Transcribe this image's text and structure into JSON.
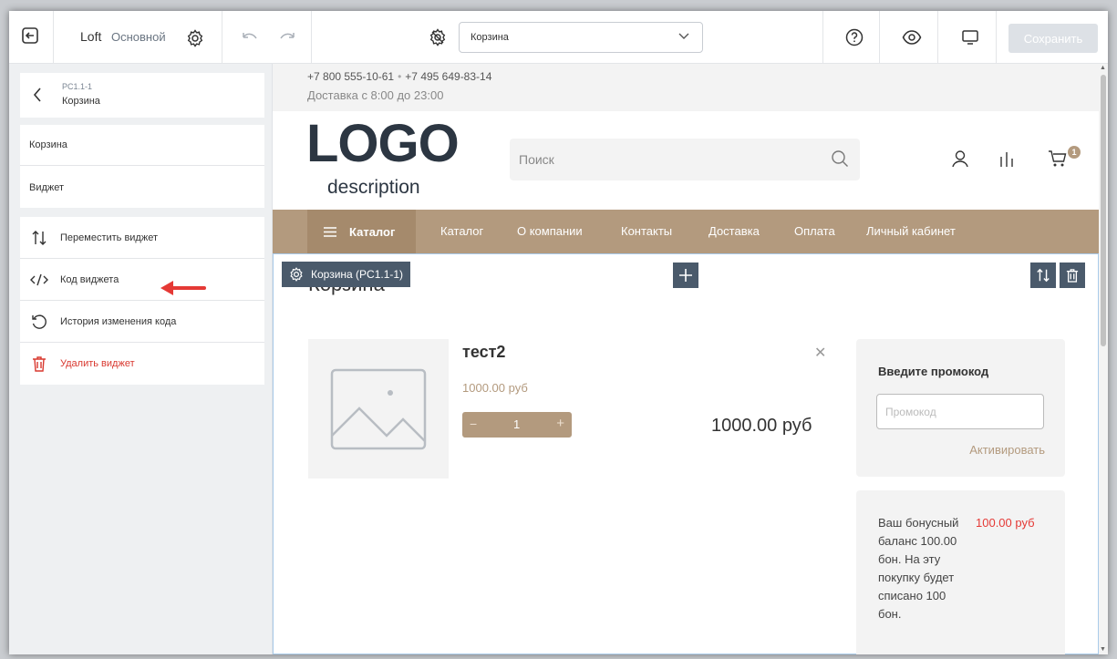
{
  "toolbar": {
    "site_name": "Loft",
    "mode": "Основной",
    "page_select": "Корзина",
    "save_label": "Сохранить"
  },
  "left_panel": {
    "breadcrumb": {
      "code": "PC1.1-1",
      "title": "Корзина"
    },
    "nav": [
      "Корзина",
      "Виджет"
    ],
    "actions": [
      {
        "label": "Переместить виджет",
        "icon": "move-arrows-icon"
      },
      {
        "label": "Код виджета",
        "icon": "code-icon"
      },
      {
        "label": "История изменения кода",
        "icon": "history-icon"
      },
      {
        "label": "Удалить виджет",
        "icon": "trash-icon"
      }
    ]
  },
  "site": {
    "phone1": "+7 800 555-10-61",
    "phone2": "+7 495 649-83-14",
    "hours": "Доставка с 8:00 до 23:00",
    "logo": "LOGO",
    "logo_desc": "description",
    "search_placeholder": "Поиск",
    "cart_count": "1",
    "menu_catalog": "Каталог",
    "menu": [
      "Каталог",
      "О компании",
      "Контакты",
      "Доставка",
      "Оплата",
      "Личный кабинет"
    ]
  },
  "widget": {
    "tag": "Корзина (PC1.1-1)",
    "title": "Корзина"
  },
  "cart": {
    "product_name": "тест2",
    "product_price": "1000.00 руб",
    "quantity": "1",
    "total": "1000.00 руб",
    "promo_title": "Введите промокод",
    "promo_placeholder": "Промокод",
    "promo_activate": "Активировать",
    "bonus_text_1": "Ваш бонусный",
    "bonus_amount": "100.00 руб",
    "bonus_text_2": "баланс 100.00",
    "bonus_text_3": "бон. На эту",
    "bonus_text_4": "покупку будет",
    "bonus_text_5": "списано 100",
    "bonus_text_6": "бон."
  },
  "colors": {
    "accent": "#b39a7e",
    "dark_tag": "#4a5a6b",
    "danger": "#d9382f"
  }
}
